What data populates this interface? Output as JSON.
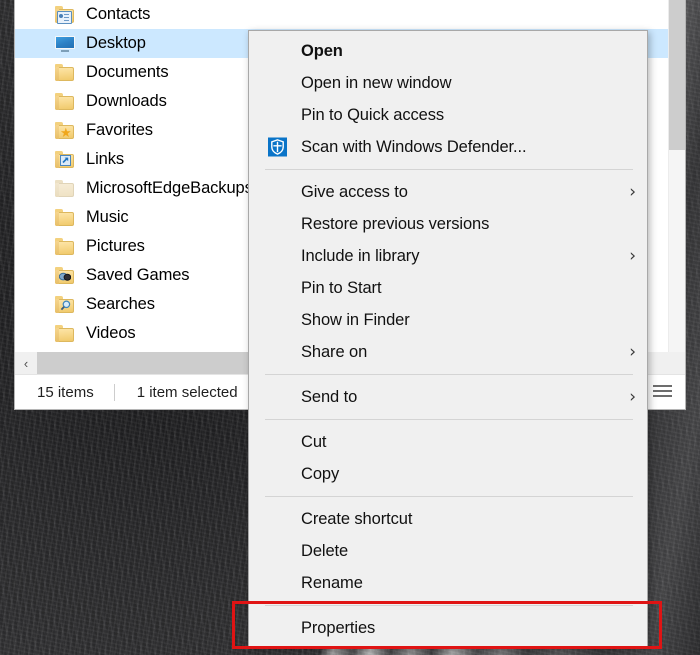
{
  "explorer": {
    "nav_tree": [
      {
        "label": "Contacts",
        "icon": "folder-contacts-icon",
        "selected": false
      },
      {
        "label": "Desktop",
        "icon": "desktop-monitor-icon",
        "selected": true
      },
      {
        "label": "Documents",
        "icon": "folder-icon",
        "selected": false
      },
      {
        "label": "Downloads",
        "icon": "folder-icon",
        "selected": false
      },
      {
        "label": "Favorites",
        "icon": "folder-favorites-icon",
        "selected": false
      },
      {
        "label": "Links",
        "icon": "folder-links-icon",
        "selected": false
      },
      {
        "label": "MicrosoftEdgeBackups",
        "icon": "folder-faded-icon",
        "selected": false
      },
      {
        "label": "Music",
        "icon": "folder-icon",
        "selected": false
      },
      {
        "label": "Pictures",
        "icon": "folder-icon",
        "selected": false
      },
      {
        "label": "Saved Games",
        "icon": "folder-games-icon",
        "selected": false
      },
      {
        "label": "Searches",
        "icon": "folder-search-icon",
        "selected": false
      },
      {
        "label": "Videos",
        "icon": "folder-icon",
        "selected": false
      }
    ],
    "scrollbar": {
      "left_arrow": "‹",
      "right_arrow": "›"
    },
    "statusbar": {
      "item_count": "15 items",
      "selection": "1 item selected",
      "view_thumbnails": "thumbnail-view-icon",
      "view_details": "details-view-icon"
    }
  },
  "context_menu": {
    "groups": [
      {
        "items": [
          {
            "label": "Open",
            "bold": true,
            "submenu": false,
            "icon": null
          },
          {
            "label": "Open in new window",
            "bold": false,
            "submenu": false,
            "icon": null
          },
          {
            "label": "Pin to Quick access",
            "bold": false,
            "submenu": false,
            "icon": null
          },
          {
            "label": "Scan with Windows Defender...",
            "bold": false,
            "submenu": false,
            "icon": "windows-defender-icon"
          }
        ]
      },
      {
        "items": [
          {
            "label": "Give access to",
            "bold": false,
            "submenu": true,
            "icon": null
          },
          {
            "label": "Restore previous versions",
            "bold": false,
            "submenu": false,
            "icon": null
          },
          {
            "label": "Include in library",
            "bold": false,
            "submenu": true,
            "icon": null
          },
          {
            "label": "Pin to Start",
            "bold": false,
            "submenu": false,
            "icon": null
          },
          {
            "label": "Show in Finder",
            "bold": false,
            "submenu": false,
            "icon": null
          },
          {
            "label": "Share on",
            "bold": false,
            "submenu": true,
            "icon": null
          }
        ]
      },
      {
        "items": [
          {
            "label": "Send to",
            "bold": false,
            "submenu": true,
            "icon": null
          }
        ]
      },
      {
        "items": [
          {
            "label": "Cut",
            "bold": false,
            "submenu": false,
            "icon": null
          },
          {
            "label": "Copy",
            "bold": false,
            "submenu": false,
            "icon": null
          }
        ]
      },
      {
        "items": [
          {
            "label": "Create shortcut",
            "bold": false,
            "submenu": false,
            "icon": null
          },
          {
            "label": "Delete",
            "bold": false,
            "submenu": false,
            "icon": null
          },
          {
            "label": "Rename",
            "bold": false,
            "submenu": false,
            "icon": null
          }
        ]
      },
      {
        "items": [
          {
            "label": "Properties",
            "bold": false,
            "submenu": false,
            "icon": null
          }
        ]
      }
    ],
    "submenu_chevron": "›"
  },
  "annotation": {
    "highlight_target": "Properties",
    "color": "#e01414"
  },
  "colors": {
    "selection_blue": "#cce8ff",
    "menu_background": "#f0f0f0",
    "menu_border": "#a8a8a8",
    "annotation_red": "#e01414"
  }
}
